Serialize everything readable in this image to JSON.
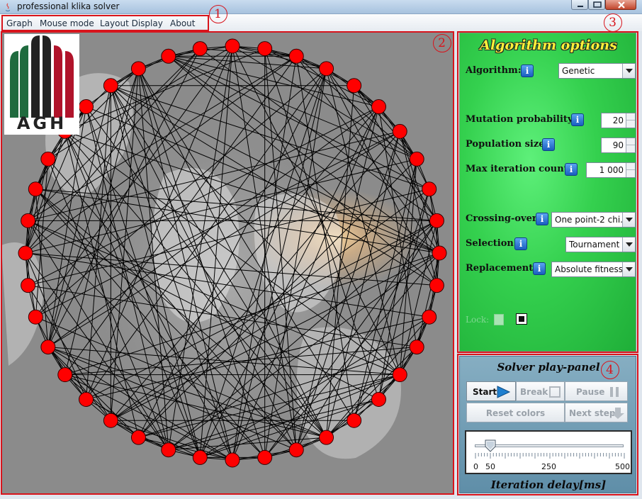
{
  "window": {
    "title": "professional klika solver"
  },
  "menu": [
    {
      "label": "Graph"
    },
    {
      "label": "Mouse mode"
    },
    {
      "label": "Layout Display"
    },
    {
      "label": "About"
    }
  ],
  "logo": {
    "text": "AGH"
  },
  "graph": {
    "node_count": 40,
    "node_color": "#ff0000",
    "edge_color": "#000000"
  },
  "options": {
    "title": "Algorithm options",
    "algorithm": {
      "label": "Algorithm:",
      "value": "Genetic"
    },
    "mutation": {
      "label": "Mutation probability:",
      "value": "20"
    },
    "population": {
      "label": "Population size:",
      "value": "90"
    },
    "max_iter": {
      "label": "Max iteration count:",
      "value": "1 000"
    },
    "crossover": {
      "label": "Crossing-over:",
      "value": "One point-2 chi..."
    },
    "selection": {
      "label": "Selection:",
      "value": "Tournament"
    },
    "replacement": {
      "label": "Replacement:",
      "value": "Absolute fitness"
    },
    "lock": {
      "label": "Lock:"
    }
  },
  "play": {
    "title": "Solver play-panel",
    "start": "Start",
    "break": "Break",
    "pause": "Pause",
    "reset": "Reset colors",
    "next": "Next step",
    "slider": {
      "min": 0,
      "max": 500,
      "value": 50,
      "ticks": [
        "0",
        "50",
        "250",
        "500"
      ]
    },
    "delay_title": "Iteration delay[ms]"
  },
  "annotations": [
    "1",
    "2",
    "3",
    "4"
  ],
  "colors": {
    "accent_red": "#d8141c",
    "options_green": "#34d04e",
    "play_blue": "#86aec2",
    "title_yellow": "#fff23a"
  }
}
